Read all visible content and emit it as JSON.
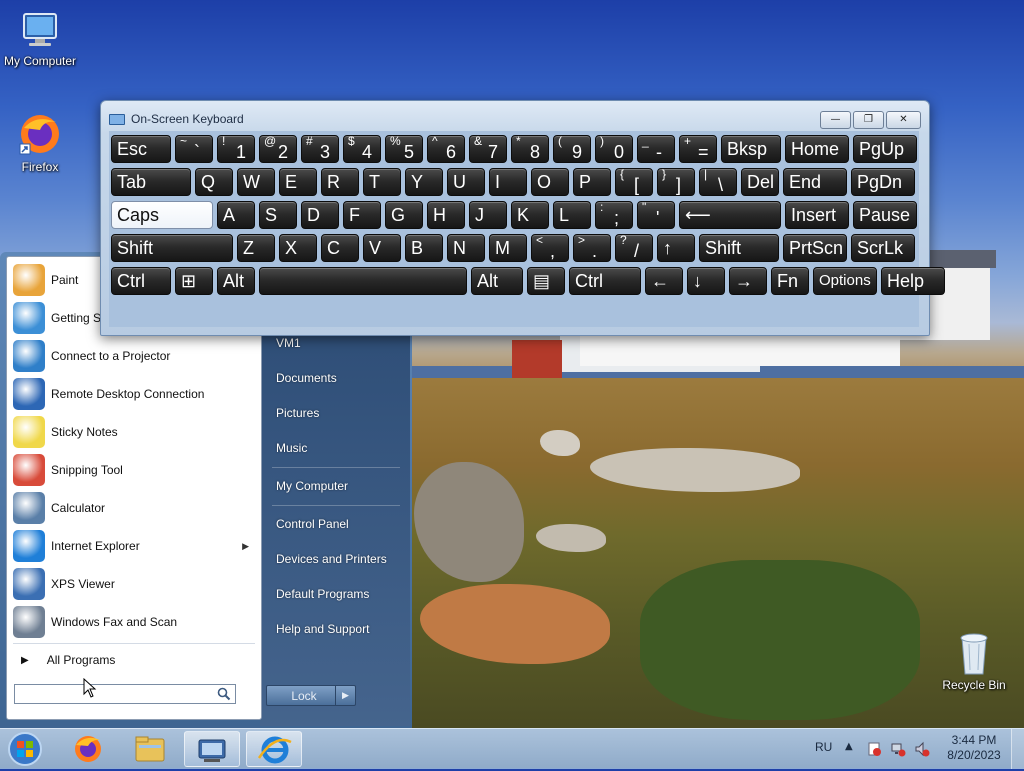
{
  "desktop": {
    "icons": [
      {
        "label": "My Computer"
      },
      {
        "label": "Firefox"
      },
      {
        "label": "Recycle Bin"
      }
    ]
  },
  "osk": {
    "title": "On-Screen Keyboard",
    "rows": [
      [
        {
          "label": "Esc"
        },
        {
          "shift": "~",
          "primary": "`"
        },
        {
          "shift": "!",
          "primary": "1"
        },
        {
          "shift": "@",
          "primary": "2"
        },
        {
          "shift": "#",
          "primary": "3"
        },
        {
          "shift": "$",
          "primary": "4"
        },
        {
          "shift": "%",
          "primary": "5"
        },
        {
          "shift": "^",
          "primary": "6"
        },
        {
          "shift": "&",
          "primary": "7"
        },
        {
          "shift": "*",
          "primary": "8"
        },
        {
          "shift": "(",
          "primary": "9"
        },
        {
          "shift": ")",
          "primary": "0"
        },
        {
          "shift": "_",
          "primary": "-"
        },
        {
          "shift": "+",
          "primary": "="
        },
        {
          "label": "Bksp"
        },
        {
          "label": "Home"
        },
        {
          "label": "PgUp"
        }
      ],
      [
        {
          "label": "Tab"
        },
        {
          "label": "Q"
        },
        {
          "label": "W"
        },
        {
          "label": "E"
        },
        {
          "label": "R"
        },
        {
          "label": "T"
        },
        {
          "label": "Y"
        },
        {
          "label": "U"
        },
        {
          "label": "I"
        },
        {
          "label": "O"
        },
        {
          "label": "P"
        },
        {
          "shift": "{",
          "primary": "["
        },
        {
          "shift": "}",
          "primary": "]"
        },
        {
          "shift": "|",
          "primary": "\\"
        },
        {
          "label": "Del"
        },
        {
          "label": "End"
        },
        {
          "label": "PgDn"
        }
      ],
      [
        {
          "label": "Caps",
          "active": true
        },
        {
          "label": "A"
        },
        {
          "label": "S"
        },
        {
          "label": "D"
        },
        {
          "label": "F"
        },
        {
          "label": "G"
        },
        {
          "label": "H"
        },
        {
          "label": "J"
        },
        {
          "label": "K"
        },
        {
          "label": "L"
        },
        {
          "shift": ":",
          "primary": ";"
        },
        {
          "shift": "\"",
          "primary": "'"
        },
        {
          "label": "⟵"
        },
        {
          "label": "Insert"
        },
        {
          "label": "Pause"
        }
      ],
      [
        {
          "label": "Shift"
        },
        {
          "label": "Z"
        },
        {
          "label": "X"
        },
        {
          "label": "C"
        },
        {
          "label": "V"
        },
        {
          "label": "B"
        },
        {
          "label": "N"
        },
        {
          "label": "M"
        },
        {
          "shift": "<",
          "primary": ","
        },
        {
          "shift": ">",
          "primary": "."
        },
        {
          "shift": "?",
          "primary": "/"
        },
        {
          "label": "↑"
        },
        {
          "label": "Shift"
        },
        {
          "label": "PrtScn"
        },
        {
          "label": "ScrLk"
        }
      ],
      [
        {
          "label": "Ctrl"
        },
        {
          "label": "⊞"
        },
        {
          "label": "Alt"
        },
        {
          "label": ""
        },
        {
          "label": "Alt"
        },
        {
          "label": "▤"
        },
        {
          "label": "Ctrl"
        },
        {
          "label": "←"
        },
        {
          "label": "↓"
        },
        {
          "label": "→"
        },
        {
          "label": "Fn"
        },
        {
          "label": "Options"
        },
        {
          "label": "Help"
        }
      ]
    ]
  },
  "start_menu": {
    "programs": [
      {
        "label": "Paint",
        "icon": "paint-icon"
      },
      {
        "label": "Getting Started",
        "icon": "getting-started-icon"
      },
      {
        "label": "Connect to a Projector",
        "icon": "projector-icon"
      },
      {
        "label": "Remote Desktop Connection",
        "icon": "remote-desktop-icon"
      },
      {
        "label": "Sticky Notes",
        "icon": "sticky-notes-icon"
      },
      {
        "label": "Snipping Tool",
        "icon": "snipping-tool-icon"
      },
      {
        "label": "Calculator",
        "icon": "calculator-icon"
      },
      {
        "label": "Internet Explorer",
        "icon": "internet-explorer-icon",
        "submenu": true
      },
      {
        "label": "XPS Viewer",
        "icon": "xps-viewer-icon"
      },
      {
        "label": "Windows Fax and Scan",
        "icon": "fax-scan-icon"
      }
    ],
    "all_programs": "All Programs",
    "search_placeholder": "",
    "right_items": [
      {
        "label": "VM1"
      },
      {
        "label": "Documents"
      },
      {
        "label": "Pictures"
      },
      {
        "label": "Music"
      },
      {
        "label": "My Computer"
      },
      {
        "label": "Control Panel"
      },
      {
        "label": "Devices and Printers"
      },
      {
        "label": "Default Programs"
      },
      {
        "label": "Help and Support"
      }
    ],
    "lock_label": "Lock"
  },
  "taskbar": {
    "language": "RU",
    "time": "3:44 PM",
    "date": "8/20/2023"
  }
}
